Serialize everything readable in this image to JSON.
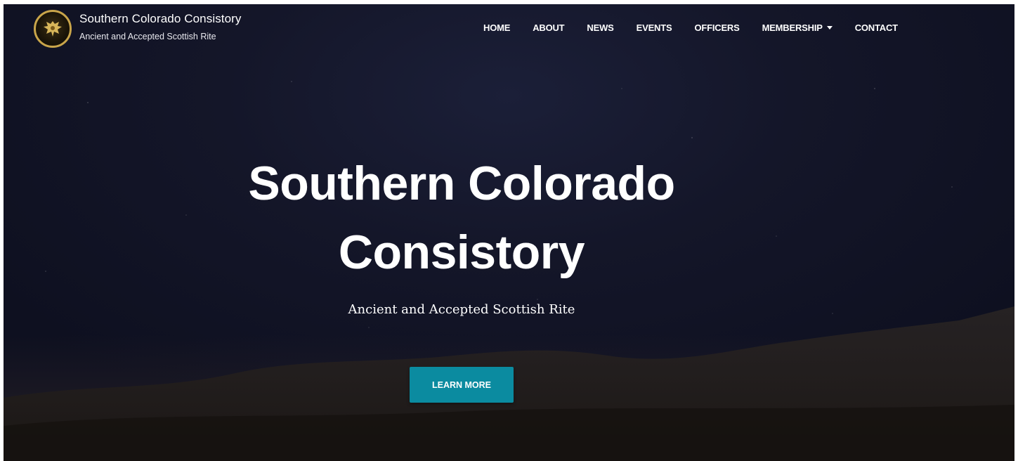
{
  "brand": {
    "title": "Southern Colorado Consistory",
    "subtitle": "Ancient and Accepted Scottish Rite",
    "logo_icon": "double-headed-eagle-icon"
  },
  "nav": {
    "items": [
      {
        "label": "HOME"
      },
      {
        "label": "ABOUT"
      },
      {
        "label": "NEWS"
      },
      {
        "label": "EVENTS"
      },
      {
        "label": "OFFICERS"
      },
      {
        "label": "MEMBERSHIP",
        "has_dropdown": true
      },
      {
        "label": "CONTACT"
      }
    ]
  },
  "hero": {
    "title_line1": "Southern Colorado",
    "title_line2": "Consistory",
    "subtitle": "Ancient and Accepted Scottish Rite",
    "button_label": "LEARN MORE"
  },
  "colors": {
    "accent": "#0b8ba0",
    "logo_ring": "#c9a54a",
    "background": "#141629"
  }
}
